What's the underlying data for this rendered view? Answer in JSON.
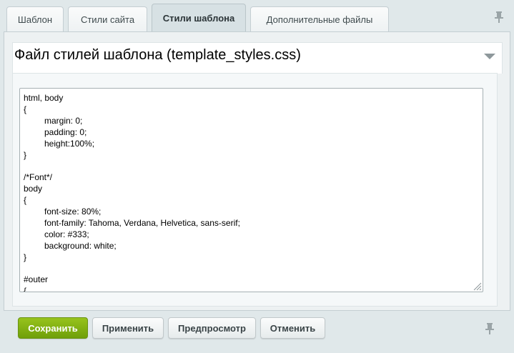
{
  "tabs": [
    {
      "label": "Шаблон",
      "active": false
    },
    {
      "label": "Стили сайта",
      "active": false
    },
    {
      "label": "Стили шаблона",
      "active": true
    },
    {
      "label": "Дополнительные файлы",
      "active": false
    }
  ],
  "section": {
    "title": "Файл стилей шаблона (template_styles.css)"
  },
  "editor": {
    "lines": [
      "html, body",
      "{",
      "margin: 0;",
      "padding: 0;",
      "height:100%;",
      "}",
      "",
      "/*Font*/",
      "body",
      "{",
      "font-size: 80%;",
      "font-family: Tahoma, Verdana, Helvetica, sans-serif;",
      "color: #333;",
      "background: white;",
      "}",
      "",
      "#outer",
      "{"
    ]
  },
  "buttons": {
    "save": "Сохранить",
    "apply": "Применить",
    "preview": "Предпросмотр",
    "cancel": "Отменить"
  },
  "icons": {
    "tab_pin": "pin-icon",
    "bottom_pin": "pin-icon",
    "collapse": "triangle-down-icon",
    "resize": "resize-grip-icon"
  },
  "colors": {
    "primary_button": "#7cad10",
    "active_tab": "#d7e1e4",
    "background": "#e0e8ea"
  }
}
